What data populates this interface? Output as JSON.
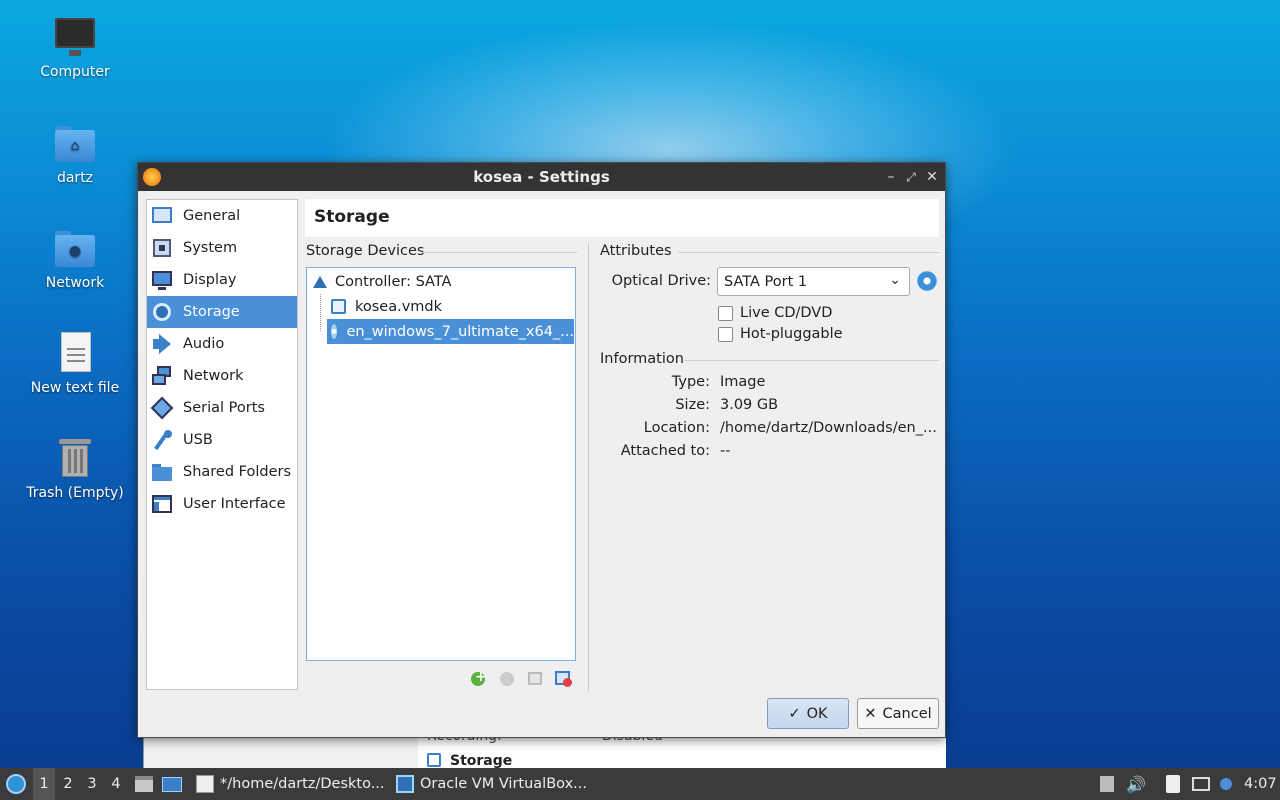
{
  "desktop": {
    "icons": [
      {
        "label": "Computer",
        "icon": "computer-icon"
      },
      {
        "label": "dartz",
        "icon": "home-folder-icon"
      },
      {
        "label": "Network",
        "icon": "network-folder-icon"
      },
      {
        "label": "New text file",
        "icon": "text-file-icon"
      },
      {
        "label": "Trash (Empty)",
        "icon": "trash-icon"
      }
    ]
  },
  "background_window": {
    "recording_label": "Recording:",
    "recording_value": "Disabled",
    "storage_label": "Storage"
  },
  "dialog": {
    "title": "kosea - Settings",
    "nav": [
      {
        "label": "General",
        "icon": "general-icon"
      },
      {
        "label": "System",
        "icon": "system-icon"
      },
      {
        "label": "Display",
        "icon": "display-icon"
      },
      {
        "label": "Storage",
        "icon": "storage-icon",
        "selected": true
      },
      {
        "label": "Audio",
        "icon": "audio-icon"
      },
      {
        "label": "Network",
        "icon": "network-icon"
      },
      {
        "label": "Serial Ports",
        "icon": "serial-ports-icon"
      },
      {
        "label": "USB",
        "icon": "usb-icon"
      },
      {
        "label": "Shared Folders",
        "icon": "shared-folders-icon"
      },
      {
        "label": "User Interface",
        "icon": "user-interface-icon"
      }
    ],
    "page_title": "Storage",
    "storage_devices_label": "Storage Devices",
    "tree": {
      "controller": "Controller: SATA",
      "items": [
        {
          "label": "kosea.vmdk",
          "icon": "hard-disk-icon"
        },
        {
          "label": "en_windows_7_ultimate_x64_...",
          "icon": "optical-disc-icon",
          "selected": true
        }
      ]
    },
    "attributes": {
      "label": "Attributes",
      "optical_drive_label": "Optical Drive:",
      "optical_drive_value": "SATA Port 1",
      "live_cd_label": "Live CD/DVD",
      "hot_pluggable_label": "Hot-pluggable"
    },
    "information": {
      "label": "Information",
      "type_label": "Type:",
      "type_value": "Image",
      "size_label": "Size:",
      "size_value": "3.09 GB",
      "location_label": "Location:",
      "location_value": "/home/dartz/Downloads/en_...",
      "attached_label": "Attached to:",
      "attached_value": "--"
    },
    "buttons": {
      "ok": "OK",
      "cancel": "Cancel"
    }
  },
  "taskbar": {
    "workspaces": [
      "1",
      "2",
      "3",
      "4"
    ],
    "tasks": [
      {
        "label": "*/home/dartz/Deskto...",
        "icon": "text-editor-icon"
      },
      {
        "label": "Oracle VM VirtualBox...",
        "icon": "virtualbox-icon"
      }
    ],
    "clock": "4:07"
  },
  "colors": {
    "selection": "#4a90d9",
    "titlebar": "#333333",
    "taskbar": "#3b3b3b"
  }
}
